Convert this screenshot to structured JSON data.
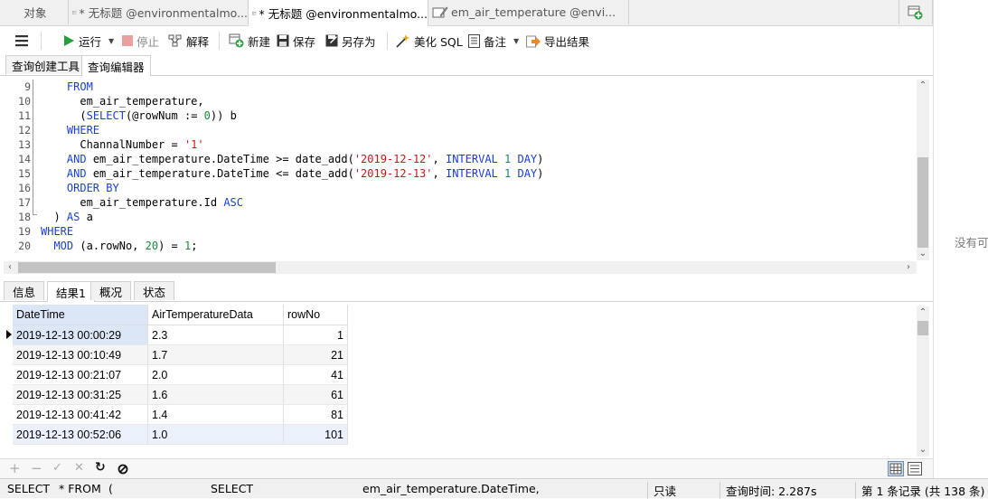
{
  "tabs": [
    {
      "label": "对象"
    },
    {
      "label": "* 无标题 @environmentalmo..."
    },
    {
      "label": "* 无标题 @environmentalmo..."
    },
    {
      "label": "em_air_temperature @envi..."
    }
  ],
  "toolbar": {
    "run": "运行",
    "stop": "停止",
    "explain": "解释",
    "new": "新建",
    "save": "保存",
    "save_as": "另存为",
    "beautify": "美化 SQL",
    "memo": "备注",
    "export": "导出结果"
  },
  "subtabs": [
    "查询创建工具",
    "查询编辑器"
  ],
  "editor": {
    "line_numbers": [
      "9",
      "10",
      "11",
      "12",
      "13",
      "14",
      "15",
      "16",
      "17",
      "18",
      "19",
      "20"
    ]
  },
  "result_tabs": [
    "信息",
    "结果1",
    "概况",
    "状态"
  ],
  "grid": {
    "columns": [
      "DateTime",
      "AirTemperatureData",
      "rowNo"
    ],
    "rows": [
      [
        "2019-12-13 00:00:29",
        "2.3",
        "1"
      ],
      [
        "2019-12-13 00:10:49",
        "1.7",
        "21"
      ],
      [
        "2019-12-13 00:21:07",
        "2.0",
        "41"
      ],
      [
        "2019-12-13 00:31:25",
        "1.6",
        "61"
      ],
      [
        "2019-12-13 00:41:42",
        "1.4",
        "81"
      ],
      [
        "2019-12-13 00:52:06",
        "1.0",
        "101"
      ]
    ]
  },
  "right_panel_text": "没有可",
  "status": {
    "sql1": "SELECT",
    "sql2": "* FROM",
    "sql3": "(",
    "sql4": "SELECT",
    "sql5": "em_air_temperature.DateTime,",
    "readonly": "只读",
    "query_time": "查询时间: 2.287s",
    "records": "第 1 条记录 (共 138 条)"
  },
  "colors": {
    "keyword": "#1a3fd6",
    "string": "#c41a16",
    "number": "#1a8a3a",
    "run_green": "#22a03a"
  }
}
